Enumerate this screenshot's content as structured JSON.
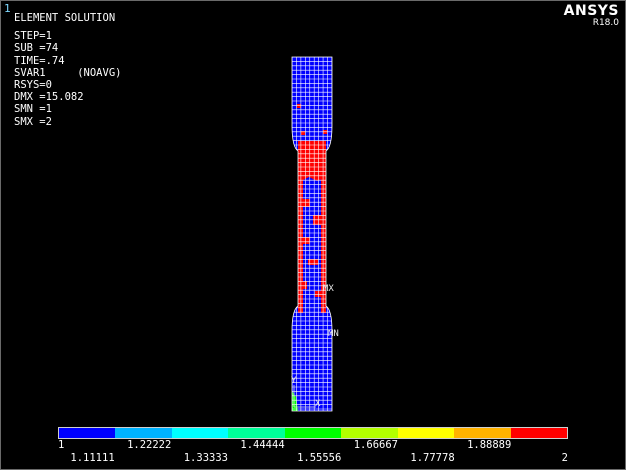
{
  "window": {
    "number": "1"
  },
  "header": {
    "title": "ELEMENT SOLUTION",
    "lines": [
      "STEP=1",
      "SUB =74",
      "TIME=.74",
      "SVAR1     (NOAVG)",
      "RSYS=0",
      "DMX =15.082",
      "SMN =1",
      "SMX =2"
    ]
  },
  "brand": {
    "logo": "ANSYS",
    "version": "R18.0"
  },
  "markers": {
    "max": "MX",
    "min": "MN",
    "axis_y": "Y",
    "axis_x": "X"
  },
  "legend": {
    "colors": [
      "#0000ff",
      "#00b3ff",
      "#00ffff",
      "#00ff99",
      "#00ff00",
      "#b3ff00",
      "#ffff00",
      "#ffb300",
      "#ff0000"
    ],
    "upper_labels": [
      "1",
      "1.22222",
      "1.44444",
      "1.66667",
      "1.88889"
    ],
    "lower_labels": [
      "1.11111",
      "1.33333",
      "1.55556",
      "1.77778",
      "2"
    ]
  },
  "colors": {
    "mesh_lines": "#ffffff",
    "min_color": "#0000ff",
    "max_color": "#ff0000",
    "low_green": "#00ff00"
  }
}
